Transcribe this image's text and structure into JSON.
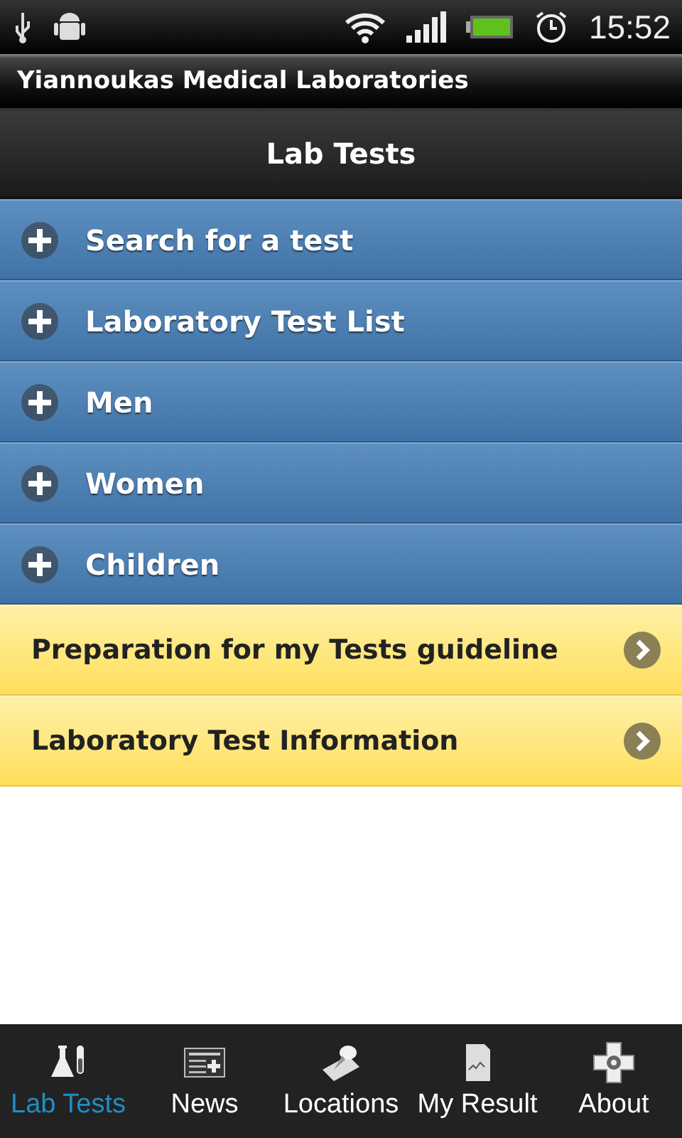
{
  "status_bar": {
    "time": "15:52"
  },
  "app_title": "Yiannoukas Medical Laboratories",
  "header": {
    "title": "Lab Tests"
  },
  "sections": [
    {
      "label": "Search for a test",
      "expanded": false
    },
    {
      "label": "Laboratory Test List",
      "expanded": false
    },
    {
      "label": "Men",
      "expanded": false
    },
    {
      "label": "Women",
      "expanded": false
    },
    {
      "label": "Children",
      "expanded": false
    }
  ],
  "links": [
    {
      "label": "Preparation for my Tests guideline"
    },
    {
      "label": "Laboratory Test Information"
    }
  ],
  "tabs": [
    {
      "label": "Lab Tests",
      "kind": "flask",
      "selected": true
    },
    {
      "label": "News",
      "kind": "newspaper",
      "selected": false
    },
    {
      "label": "Locations",
      "kind": "map",
      "selected": false
    },
    {
      "label": "My Result",
      "kind": "document",
      "selected": false
    },
    {
      "label": "About",
      "kind": "cross",
      "selected": false
    }
  ]
}
